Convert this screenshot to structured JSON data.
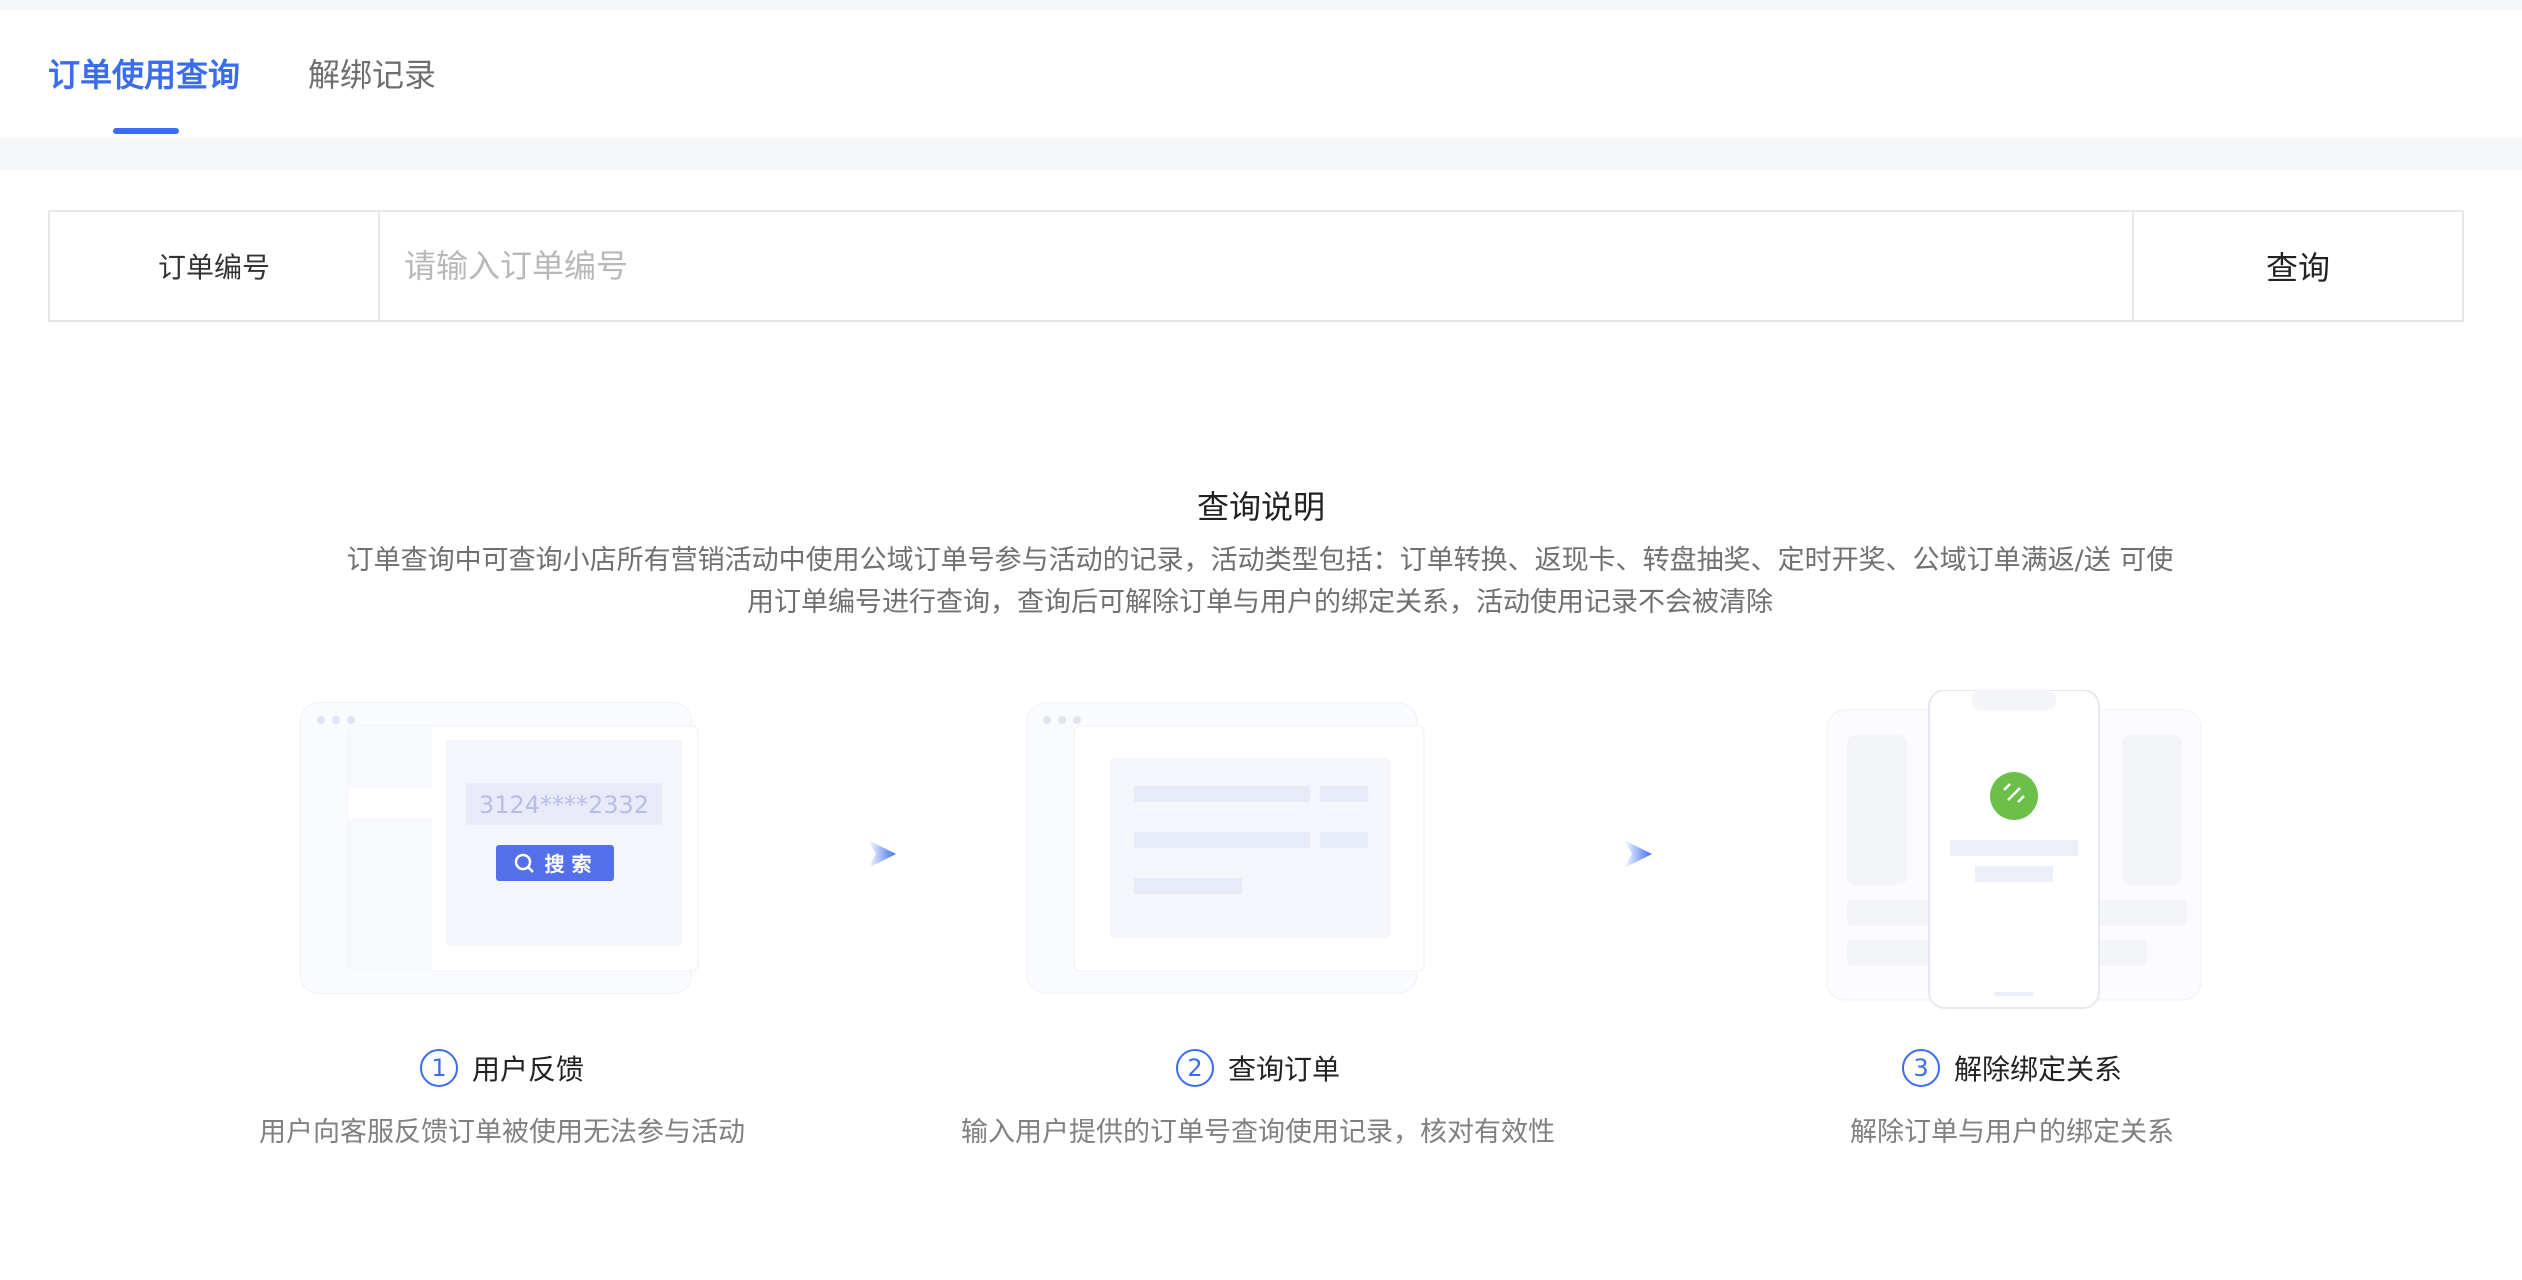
{
  "tabs": [
    {
      "label": "订单使用查询",
      "active": true
    },
    {
      "label": "解绑记录",
      "active": false
    }
  ],
  "search": {
    "label": "订单编号",
    "placeholder": "请输入订单编号",
    "button_label": "查询"
  },
  "description": {
    "title": "查询说明",
    "text": "订单查询中可查询小店所有营销活动中使用公域订单号参与活动的记录，活动类型包括：订单转换、返现卡、转盘抽奖、定时开奖、公域订单满返/送 可使用订单编号进行查询，查询后可解除订单与用户的绑定关系，活动使用记录不会被清除"
  },
  "illustration": {
    "sample_order": "3124****2332",
    "search_button": "搜 索"
  },
  "steps": [
    {
      "num": "1",
      "title": "用户反馈",
      "desc": "用户向客服反馈订单被使用无法参与活动",
      "icon": "feedback-illustration"
    },
    {
      "num": "2",
      "title": "查询订单",
      "desc": "输入用户提供的订单号查询使用记录，核对有效性",
      "icon": "query-illustration"
    },
    {
      "num": "3",
      "title": "解除绑定关系",
      "desc": "解除订单与用户的绑定关系",
      "icon": "unbind-illustration"
    }
  ],
  "colors": {
    "accent": "#3a6cf0",
    "success": "#6cc04a",
    "button": "#5470e8"
  }
}
